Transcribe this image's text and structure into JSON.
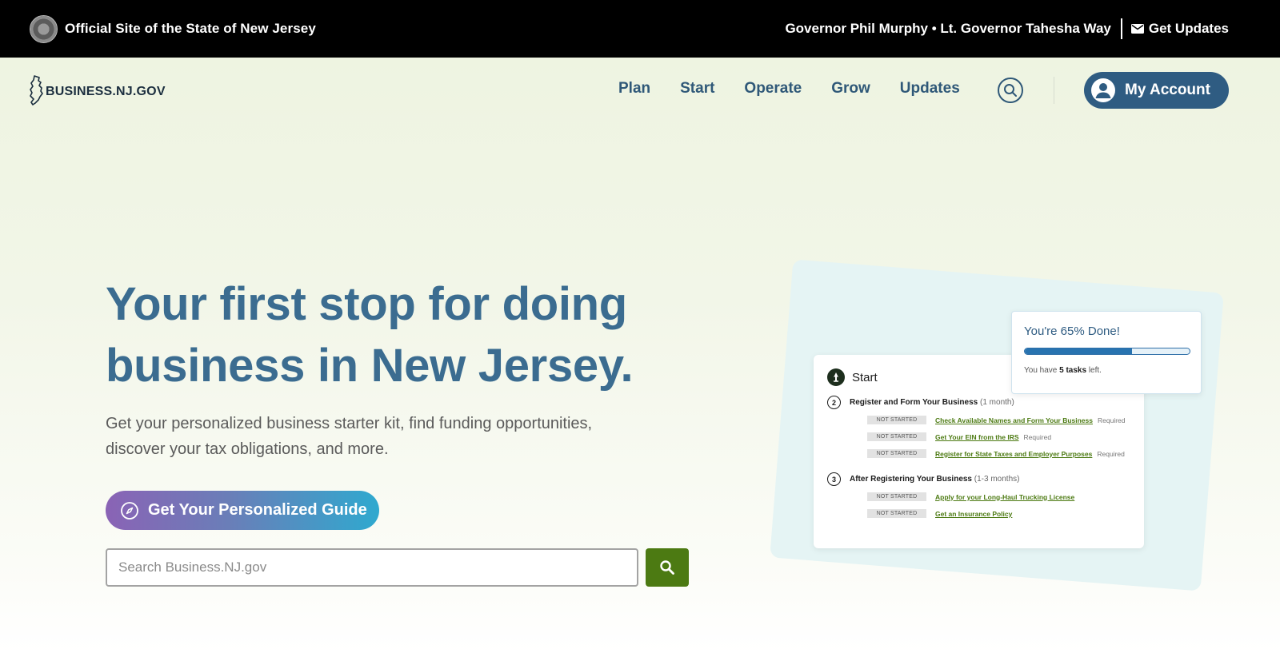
{
  "topbar": {
    "site_title": "Official Site of the State of New Jersey",
    "governor": "Governor Phil Murphy • Lt. Governor Tahesha Way",
    "updates_label": "Get Updates"
  },
  "nav": {
    "logo_text": "BUSINESS.NJ.GOV",
    "links": [
      "Plan",
      "Start",
      "Operate",
      "Grow",
      "Updates"
    ],
    "account_label": "My Account"
  },
  "hero": {
    "headline": "Your first stop for doing business in New Jersey.",
    "subtext": "Get your personalized business starter kit, find funding opportunities, discover your tax obligations, and more.",
    "guide_button": "Get Your Personalized Guide",
    "search_placeholder": "Search Business.NJ.gov"
  },
  "illustration": {
    "card_title": "Start",
    "steps": [
      {
        "number": "2",
        "title": "Register and Form Your Business",
        "duration": "(1 month)",
        "tasks": [
          {
            "status": "NOT STARTED",
            "label": "Check Available Names and Form Your Business",
            "note": "Required"
          },
          {
            "status": "NOT STARTED",
            "label": "Get Your EIN from the IRS",
            "note": "Required"
          },
          {
            "status": "NOT STARTED",
            "label": "Register for State Taxes and Employer Purposes",
            "note": "Required"
          }
        ]
      },
      {
        "number": "3",
        "title": "After Registering Your Business",
        "duration": "(1-3 months)",
        "tasks": [
          {
            "status": "NOT STARTED",
            "label": "Apply for your Long-Haul Trucking License",
            "note": ""
          },
          {
            "status": "NOT STARTED",
            "label": "Get an Insurance Policy",
            "note": ""
          }
        ]
      }
    ],
    "progress": {
      "title": "You're 65% Done!",
      "percent": 65,
      "note_prefix": "You have",
      "note_count": "5 tasks",
      "note_suffix": "left."
    }
  },
  "colors": {
    "accent_blue": "#2f5c82",
    "headline_blue": "#3b6c90",
    "green": "#4c7a12"
  }
}
